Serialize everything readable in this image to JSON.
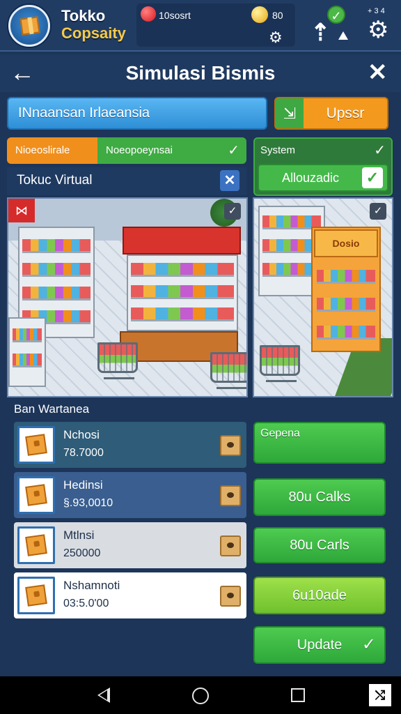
{
  "app": {
    "title_line1": "Tokko",
    "title_line2": "Copsaity"
  },
  "resources": {
    "red_value": "10sosrt",
    "coin_value": "80"
  },
  "top_right": {
    "status_text": "+ 3 4"
  },
  "header": {
    "title": "Simulasi Bismis"
  },
  "store": {
    "name_value": "INnaansan Irlaeansia",
    "upgrade_label": "Upssr"
  },
  "tabs": {
    "orange_label": "Nioeoslirale",
    "green_label": "Noeopoeynsai"
  },
  "system": {
    "label": "System",
    "button_label": "Allouzadic"
  },
  "virtual": {
    "label": "Tokuc Virtual"
  },
  "scene": {
    "side_sign": "Dosio"
  },
  "inventory": {
    "title": "Ban Wartanea",
    "items": [
      {
        "name": "Nchosi",
        "value": "78.7000"
      },
      {
        "name": "Hedinsi",
        "value": "§.93,0010"
      },
      {
        "name": "Mtlnsi",
        "value": "250000"
      },
      {
        "name": "Nshamnoti",
        "value": "03:5.0'00"
      }
    ]
  },
  "actions": {
    "a1": "Gepena",
    "a2": "80u Calks",
    "a3": "80u Carls",
    "a4": "6u10ade",
    "a5": "Update"
  },
  "colors": {
    "accent_green": "#3fab43",
    "accent_orange": "#f08f1c",
    "accent_blue": "#2f8fd6",
    "background": "#1d3559"
  }
}
